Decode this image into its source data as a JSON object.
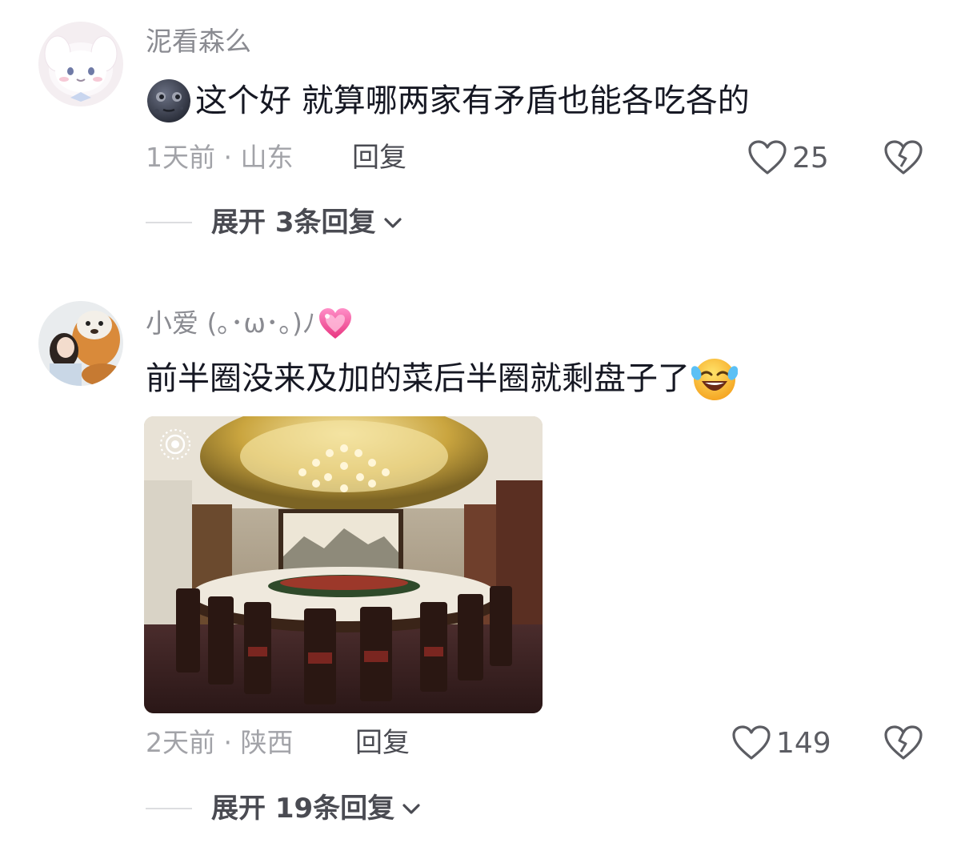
{
  "comments": [
    {
      "username": "泥看森么",
      "text": "这个好 就算哪两家有矛盾也能各吃各的",
      "leading_emoji": "dark-moon-face-emoji",
      "time_location": "1天前 · 山东",
      "reply_label": "回复",
      "likes": "25",
      "expand_label": "展开 3条回复"
    },
    {
      "username": "小爱 (｡･ω･｡)ﾉ",
      "username_emoji": "pink-sparkling-heart-emoji",
      "text": "前半圈没来及加的菜后半圈就剩盘子了",
      "trailing_emoji": "rolling-laughing-emoji",
      "time_location": "2天前 · 陕西",
      "reply_label": "回复",
      "likes": "149",
      "expand_label": "展开 19条回复",
      "image": "banquet-hall-round-table-photo"
    }
  ],
  "icons": {
    "like": "heart-outline-icon",
    "dislike": "broken-heart-icon",
    "expand": "chevron-down-icon",
    "live_photo": "live-photo-icon"
  },
  "colors": {
    "text_primary": "#161823",
    "text_secondary": "#8a8b91",
    "meta": "#a2a3a8",
    "divider": "#dcdde0"
  }
}
